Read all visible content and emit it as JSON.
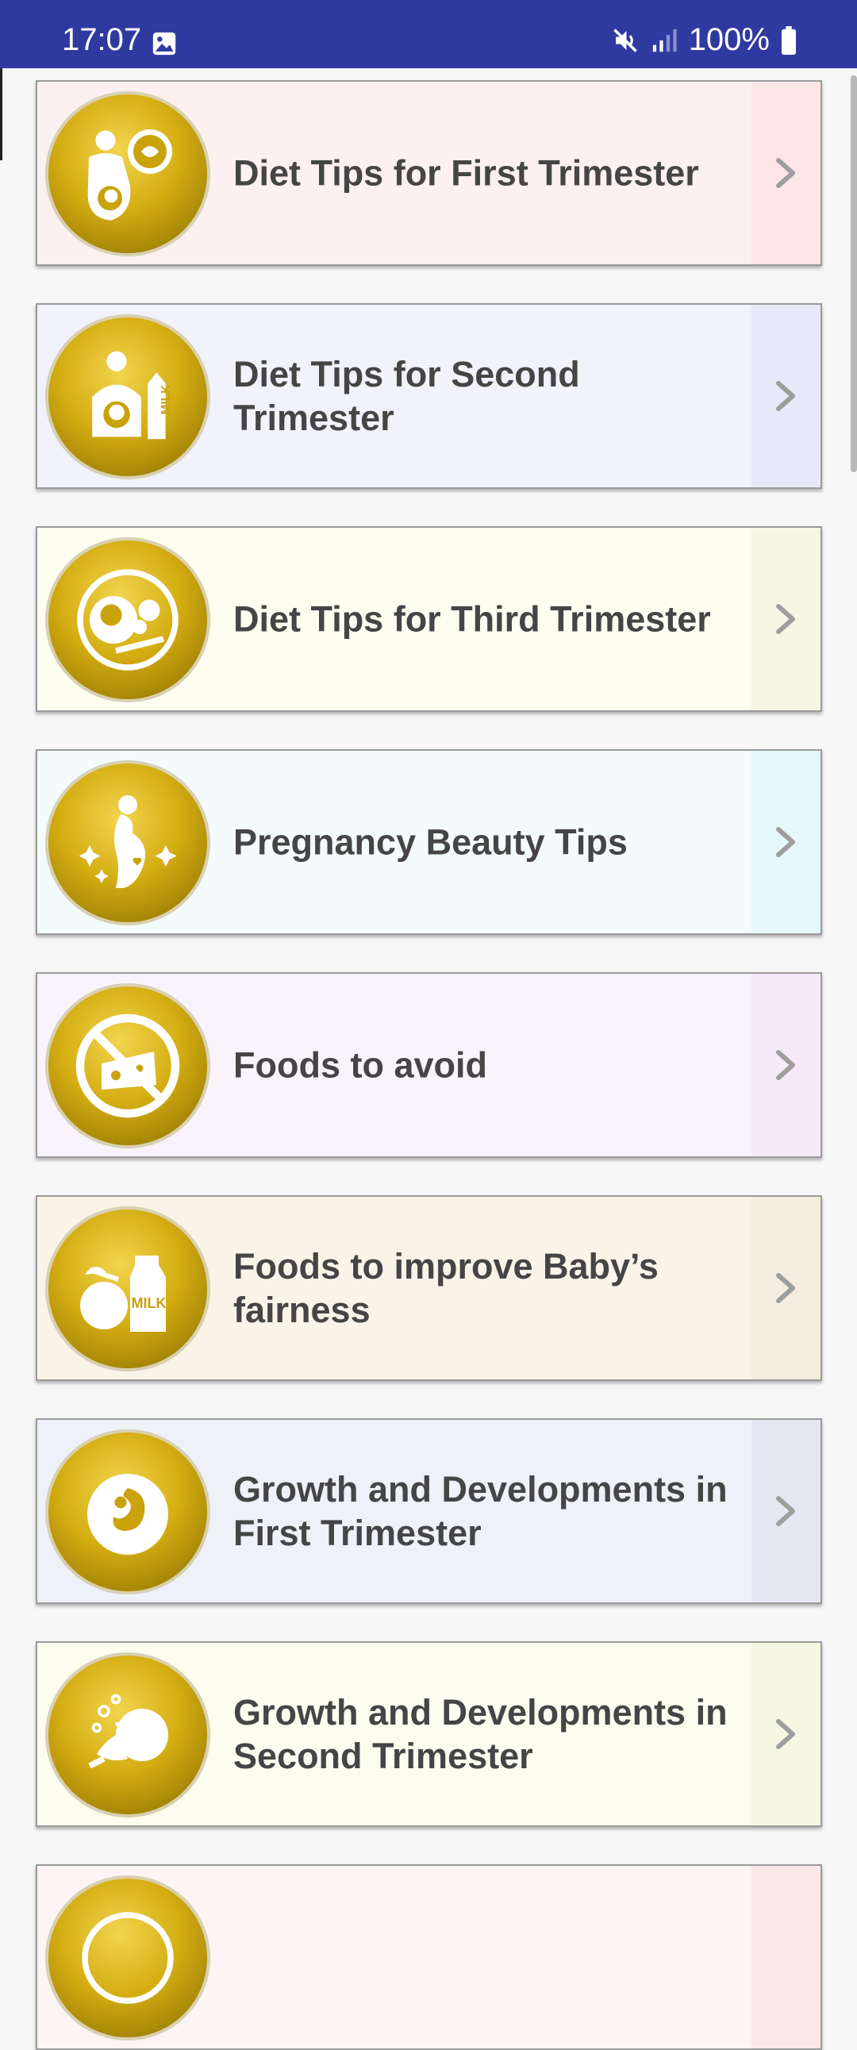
{
  "status_bar": {
    "time": "17:07",
    "battery": "100%"
  },
  "cards": [
    {
      "label": "Diet Tips for First Trimester",
      "bg": "#fdf0f0",
      "accent": "#fde6e6",
      "icon": "pregnant-mother-food-icon"
    },
    {
      "label": "Diet Tips for Second Trimester",
      "bg": "#f1f2fb",
      "accent": "#e8e9f8",
      "icon": "pregnant-belly-milk-icon"
    },
    {
      "label": "Diet Tips for Third Trimester",
      "bg": "#fdfdf0",
      "accent": "#f7f6e4",
      "icon": "fetus-fruit-plate-icon"
    },
    {
      "label": "Pregnancy Beauty Tips",
      "bg": "#f3fbfd",
      "accent": "#e6f7fb",
      "icon": "pregnant-woman-sparkles-icon"
    },
    {
      "label": "Foods to avoid",
      "bg": "#f9f3fb",
      "accent": "#f6eafa",
      "icon": "no-cheese-icon"
    },
    {
      "label": "Foods to improve Baby’s fairness",
      "bg": "#faf3e8",
      "accent": "#f5ecdf",
      "icon": "coconut-milk-icon"
    },
    {
      "label": "Growth and Developments in First Trimester",
      "bg": "#eff1f9",
      "accent": "#e5e7f3",
      "icon": "embryo-icon"
    },
    {
      "label": "Growth and Developments in Second Trimester",
      "bg": "#fcfcef",
      "accent": "#f6f7e2",
      "icon": "fetus-bubbles-icon"
    },
    {
      "label": "",
      "bg": "#fdf4f4",
      "accent": "#fbe9e9",
      "icon": "next-topic-icon"
    }
  ]
}
